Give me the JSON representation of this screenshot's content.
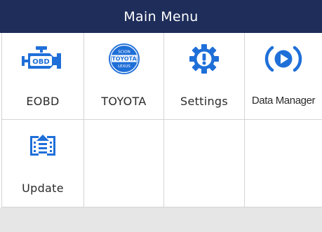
{
  "header": {
    "title": "Main Menu"
  },
  "menu": {
    "items": [
      {
        "label": "EOBD",
        "icon": "engine-obd-icon"
      },
      {
        "label": "TOYOTA",
        "icon": "toyota-badge-icon",
        "badge_lines": [
          "SCION",
          "TOYOTA",
          "LEXUS"
        ]
      },
      {
        "label": "Settings",
        "icon": "gear-icon"
      },
      {
        "label": "Data Manager",
        "icon": "play-circle-icon"
      },
      {
        "label": "Update",
        "icon": "update-icon"
      }
    ]
  },
  "colors": {
    "title_bar": "#1e2d5a",
    "icon_blue": "#1f6fd8",
    "grid_line": "#d4d4d4",
    "bottom_bar": "#e6e6e6"
  }
}
